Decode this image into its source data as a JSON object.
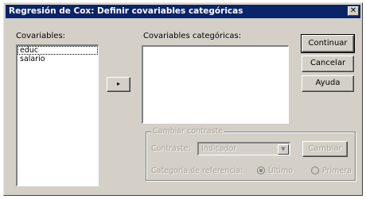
{
  "dialog": {
    "title": "Regresión de Cox: Definir covariables categóricas",
    "close_glyph": "✕"
  },
  "covariables": {
    "label": "Covariables:",
    "items": [
      "educ",
      "salario"
    ]
  },
  "move_button_glyph": "▸",
  "categorical": {
    "label": "Covariables categóricas:",
    "items": []
  },
  "buttons": {
    "continue": "Continuar",
    "cancel": "Cancelar",
    "help": "Ayuda"
  },
  "change_contrast": {
    "legend": "Cambiar contraste",
    "contrast_label": "Contraste:",
    "contrast_value": "Indicador",
    "change_button": "Cambiar",
    "reference_label": "Categoría de referencia:",
    "option_last": "Último",
    "option_first": "Primera",
    "selected": "last"
  }
}
